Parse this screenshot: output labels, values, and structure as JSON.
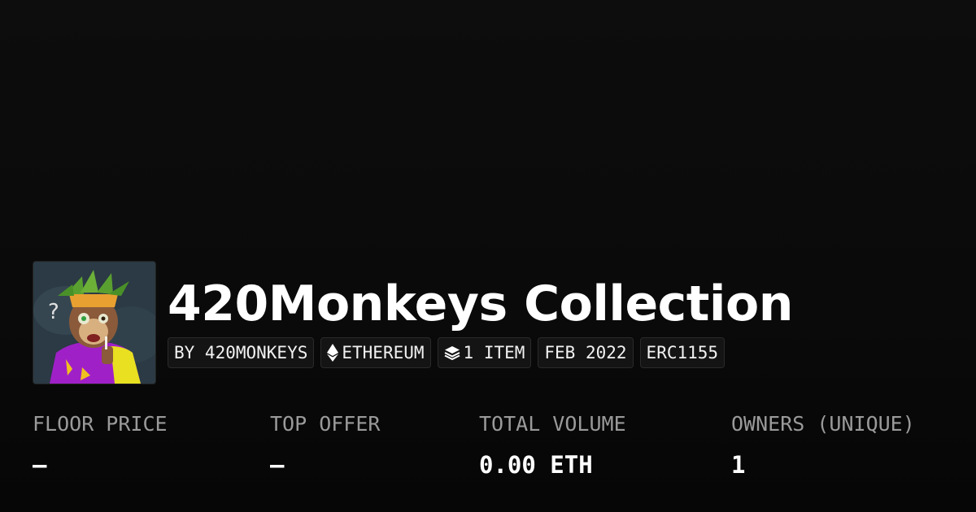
{
  "collection": {
    "title": "420Monkeys Collection",
    "avatar_icon": "monkey-avatar-image"
  },
  "tags": [
    {
      "label": "BY 420MONKEYS",
      "icon": null
    },
    {
      "label": "ETHEREUM",
      "icon": "ethereum-icon"
    },
    {
      "label": "1 ITEM",
      "icon": "layers-icon"
    },
    {
      "label": "FEB 2022",
      "icon": null
    },
    {
      "label": "ERC1155",
      "icon": null
    }
  ],
  "stats": [
    {
      "label": "FLOOR PRICE",
      "value": "—"
    },
    {
      "label": "TOP OFFER",
      "value": "—"
    },
    {
      "label": "TOTAL VOLUME",
      "value": "0.00 ETH"
    },
    {
      "label": "OWNERS (UNIQUE)",
      "value": "1"
    }
  ],
  "colors": {
    "background": "#0a0a0a",
    "text": "#ffffff",
    "muted": "#9a9a9a",
    "tag_bg": "#141414",
    "tag_border": "#2a2a2a"
  }
}
